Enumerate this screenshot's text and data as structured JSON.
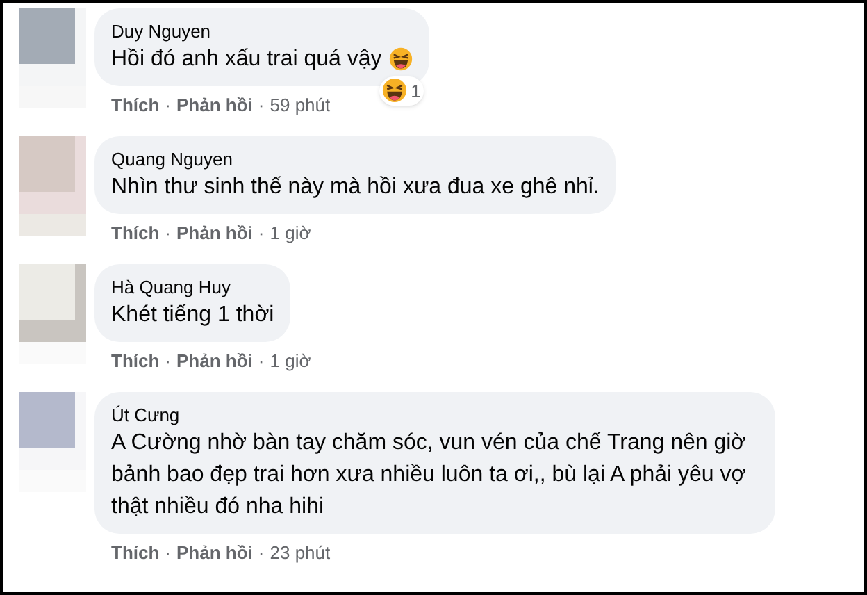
{
  "comments": [
    {
      "name": "Duy Nguyen",
      "text": "Hồi đó anh xấu trai quá vậy",
      "emoji": true,
      "reaction_count": "1",
      "like": "Thích",
      "separator": "·",
      "reply": "Phản hồi",
      "time": "59 phút"
    },
    {
      "name": "Quang Nguyen",
      "text": "Nhìn thư sinh thế này mà hồi xưa đua xe ghê nhỉ.",
      "emoji": false,
      "like": "Thích",
      "separator": "·",
      "reply": "Phản hồi",
      "time": "1 giờ"
    },
    {
      "name": "Hà Quang Huy",
      "text": "Khét tiếng 1 thời",
      "emoji": false,
      "like": "Thích",
      "separator": "·",
      "reply": "Phản hồi",
      "time": "1 giờ"
    },
    {
      "name": "Út Cưng",
      "text": "A Cường nhờ bàn tay chăm sóc, vun vén của chế Trang nên giờ bảnh bao đẹp trai hơn xưa nhiều luôn ta ơi,, bù lại A phải yêu vợ thật nhiều đó nha hihi",
      "emoji": false,
      "like": "Thích",
      "separator": "·",
      "reply": "Phản hồi",
      "time": "23 phút"
    }
  ]
}
